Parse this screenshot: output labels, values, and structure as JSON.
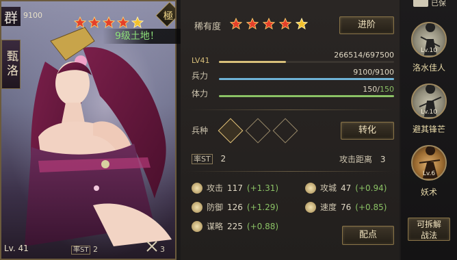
{
  "card": {
    "faction": "群",
    "power": "9100",
    "name": "甄洛",
    "quality": "極",
    "level": "Lv. 41",
    "rate_value": "2",
    "dist_value": "3",
    "stars": 5
  },
  "banner": {
    "text": "9级土地！"
  },
  "top_right": {
    "status": "已保"
  },
  "rarity": {
    "label": "稀有度",
    "stars": 5
  },
  "buttons": {
    "advance": "进阶",
    "transform": "转化",
    "allocate": "配点",
    "split": "可拆解",
    "split2": "战法"
  },
  "stats": {
    "level_label": "LV41",
    "xp": "266514/697500",
    "xp_fraction": 0.382,
    "troops_label": "兵力",
    "troops": "9100/9100",
    "troops_fraction": 1.0,
    "stamina_label": "体力",
    "stamina_current": "150",
    "stamina_sep": "/",
    "stamina_max": "150",
    "stamina_fraction": 1.0
  },
  "arms": {
    "label": "兵种"
  },
  "rate": {
    "label": "率ST",
    "value": "2"
  },
  "range": {
    "label": "攻击距离",
    "value": "3"
  },
  "attributes": [
    {
      "name": "攻击",
      "value": "117",
      "bonus": "(+1.31)"
    },
    {
      "name": "攻城",
      "value": "47",
      "bonus": "(+0.94)"
    },
    {
      "name": "防御",
      "value": "126",
      "bonus": "(+1.29)"
    },
    {
      "name": "速度",
      "value": "76",
      "bonus": "(+0.85)"
    },
    {
      "name": "谋略",
      "value": "225",
      "bonus": "(+0.88)"
    }
  ],
  "skills": [
    {
      "level": "Lv.10",
      "name": "洛水佳人"
    },
    {
      "level": "Lv.10",
      "name": "避其锋芒"
    },
    {
      "level": "Lv.6",
      "name": "妖术"
    }
  ],
  "colors": {
    "accent_gold": "#d9b86a",
    "xp_bar": "#d9c07a",
    "troops_bar": "#6fb3d6",
    "stamina_bar": "#8bc265",
    "star": "#e4402a",
    "star_gold": "#f2c12e"
  }
}
